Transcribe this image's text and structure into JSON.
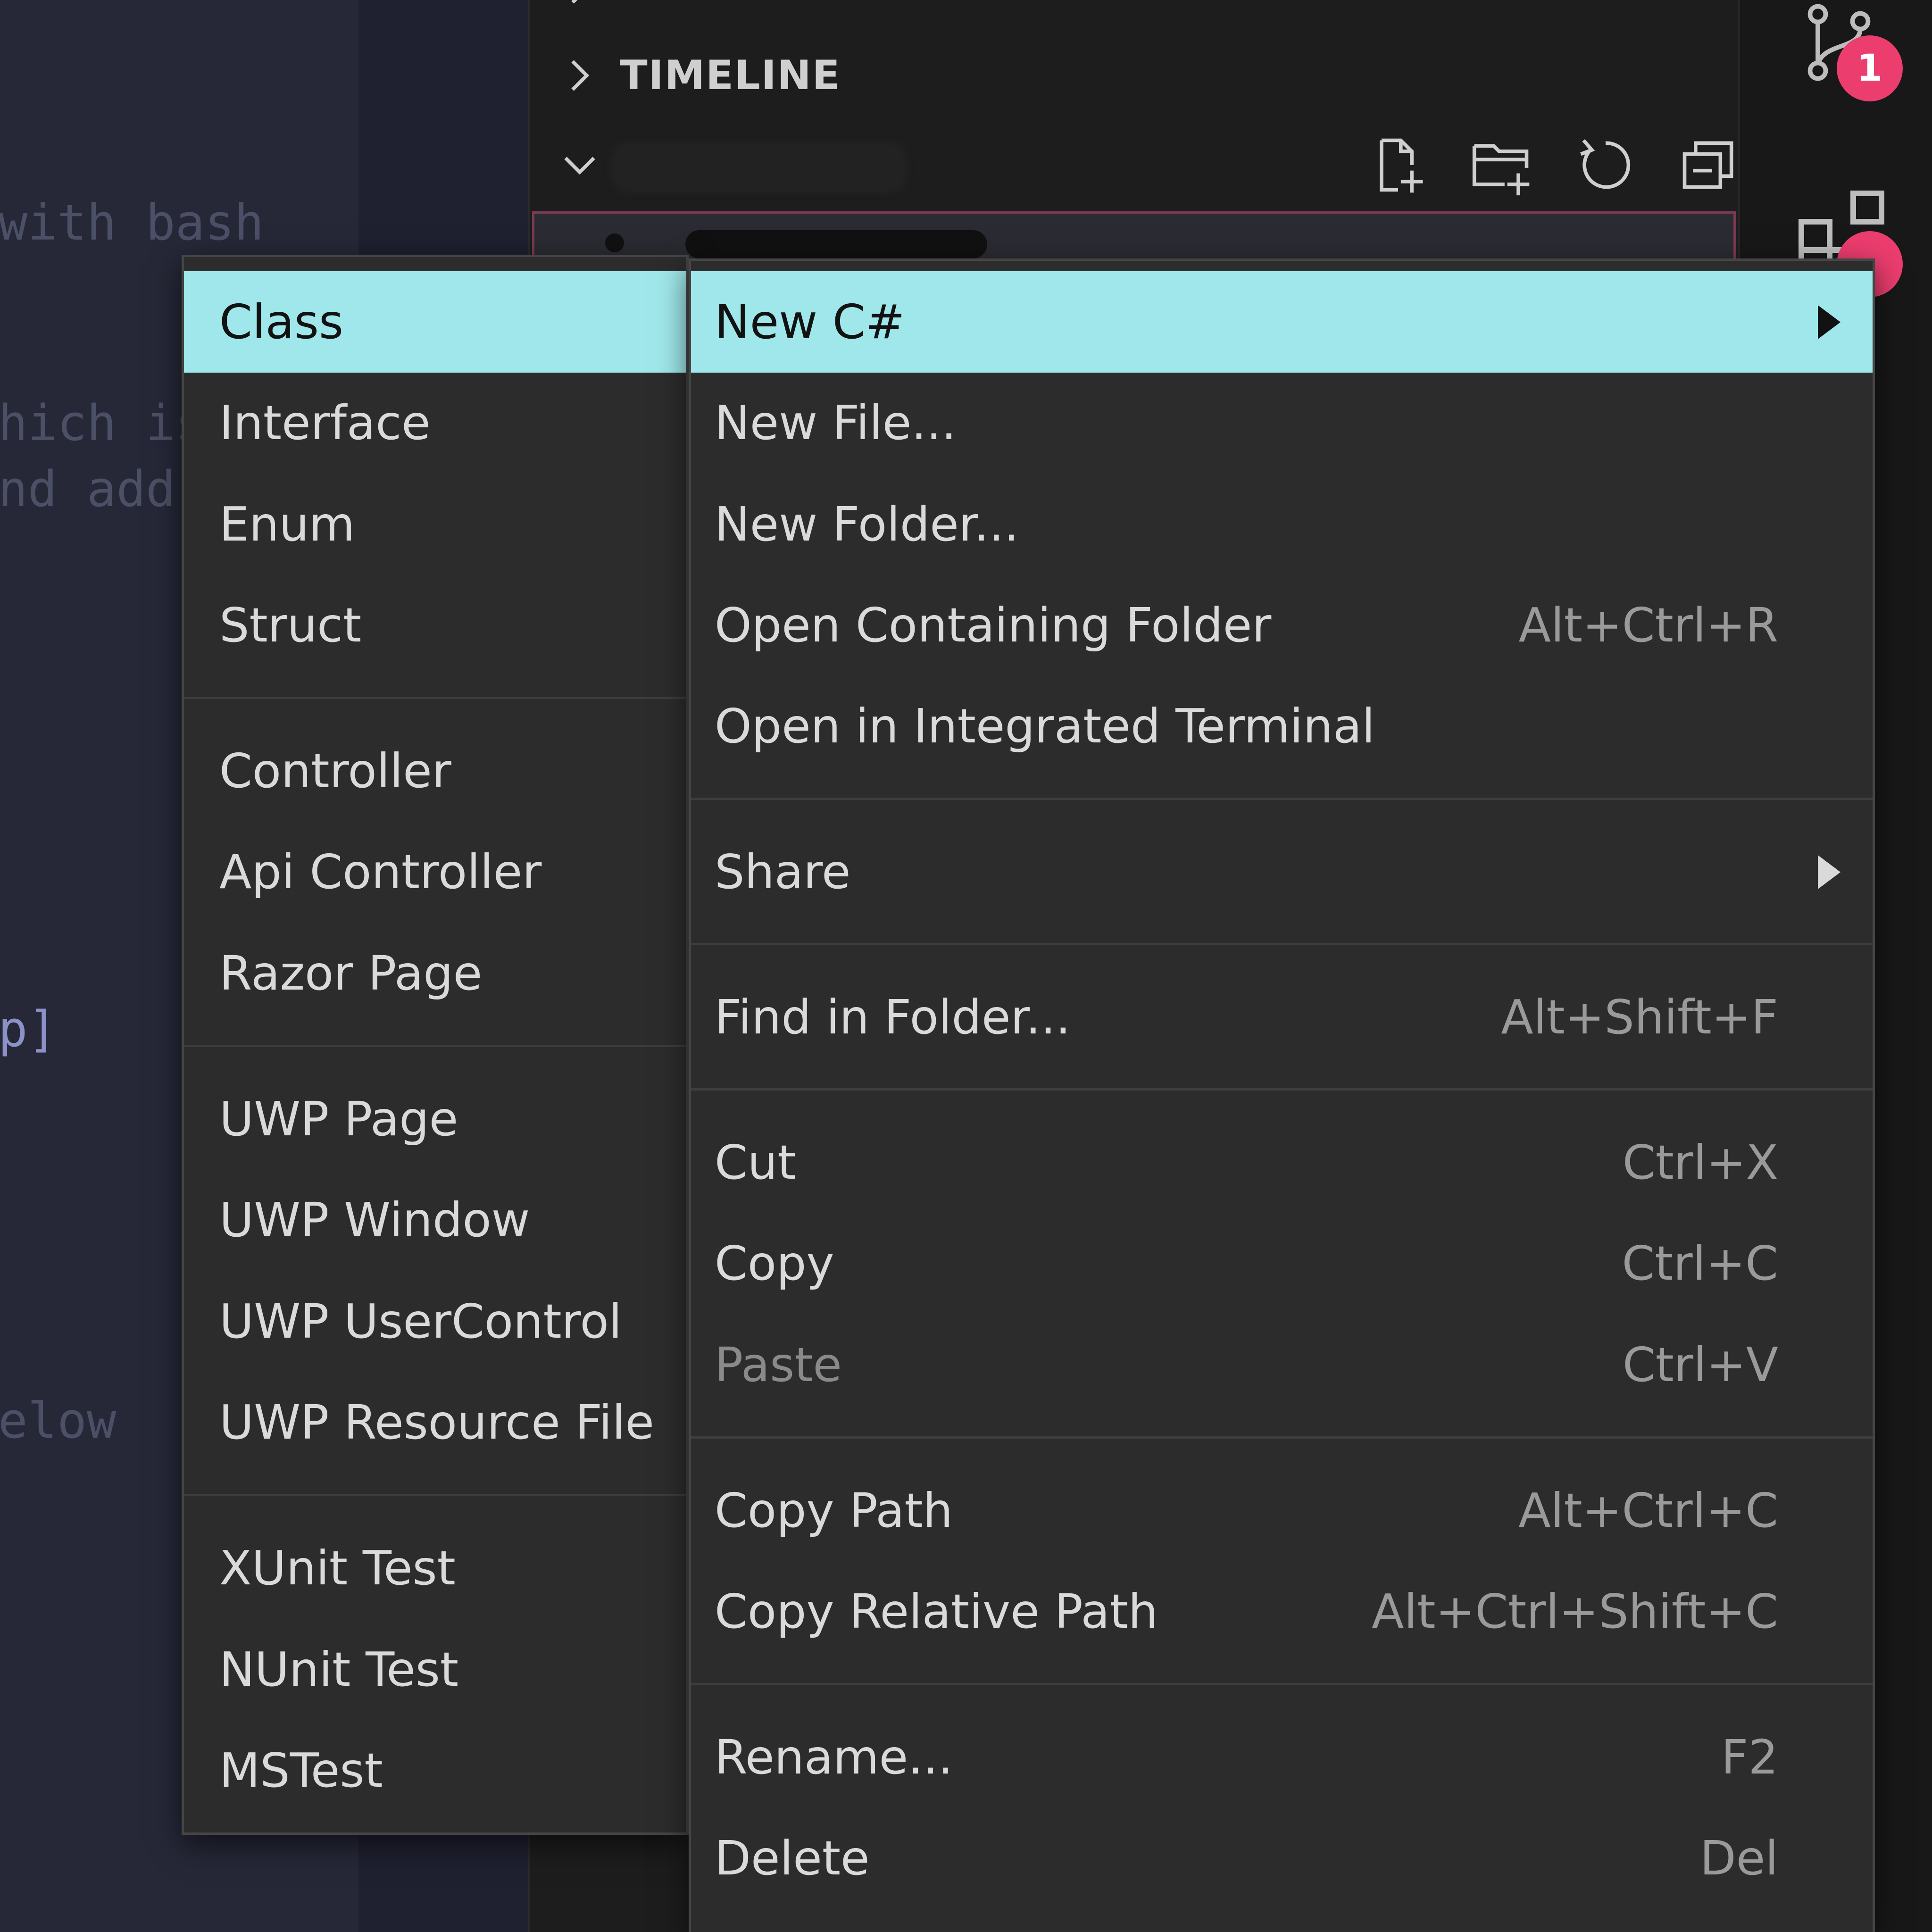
{
  "editor": {
    "fragments": [
      "with bash",
      "hich is",
      "nd add",
      "p]",
      "elow"
    ]
  },
  "sidebar": {
    "sections": [
      {
        "label": "TIMELINE",
        "expanded": false
      }
    ]
  },
  "activity_bar": {
    "badges": [
      "1"
    ]
  },
  "submenu": {
    "title": "New C#",
    "groups": [
      [
        "Class",
        "Interface",
        "Enum",
        "Struct"
      ],
      [
        "Controller",
        "Api Controller",
        "Razor Page"
      ],
      [
        "UWP Page",
        "UWP Window",
        "UWP UserControl",
        "UWP Resource File"
      ],
      [
        "XUnit Test",
        "NUnit Test",
        "MSTest"
      ]
    ],
    "active": "Class"
  },
  "context_menu": {
    "groups": [
      [
        {
          "label": "New C#",
          "shortcut": "",
          "has_submenu": true,
          "active": true
        },
        {
          "label": "New File...",
          "shortcut": ""
        },
        {
          "label": "New Folder...",
          "shortcut": ""
        },
        {
          "label": "Open Containing Folder",
          "shortcut": "Alt+Ctrl+R"
        },
        {
          "label": "Open in Integrated Terminal",
          "shortcut": ""
        }
      ],
      [
        {
          "label": "Share",
          "shortcut": "",
          "has_submenu": true
        }
      ],
      [
        {
          "label": "Find in Folder...",
          "shortcut": "Alt+Shift+F"
        }
      ],
      [
        {
          "label": "Cut",
          "shortcut": "Ctrl+X"
        },
        {
          "label": "Copy",
          "shortcut": "Ctrl+C"
        },
        {
          "label": "Paste",
          "shortcut": "Ctrl+V",
          "disabled": true
        }
      ],
      [
        {
          "label": "Copy Path",
          "shortcut": "Alt+Ctrl+C"
        },
        {
          "label": "Copy Relative Path",
          "shortcut": "Alt+Ctrl+Shift+C"
        }
      ],
      [
        {
          "label": "Rename...",
          "shortcut": "F2"
        },
        {
          "label": "Delete",
          "shortcut": "Del"
        }
      ]
    ]
  },
  "colors": {
    "highlight": "#9fe7ea",
    "menu_bg": "#2c2c2c",
    "badge": "#ec3d6f"
  },
  "icons": {
    "toolbar": [
      "new-file-icon",
      "new-folder-icon",
      "refresh-icon",
      "collapse-all-icon"
    ],
    "activity": [
      "source-control-icon",
      "extensions-icon"
    ],
    "submenu_arrow": "triangle-right-icon"
  }
}
